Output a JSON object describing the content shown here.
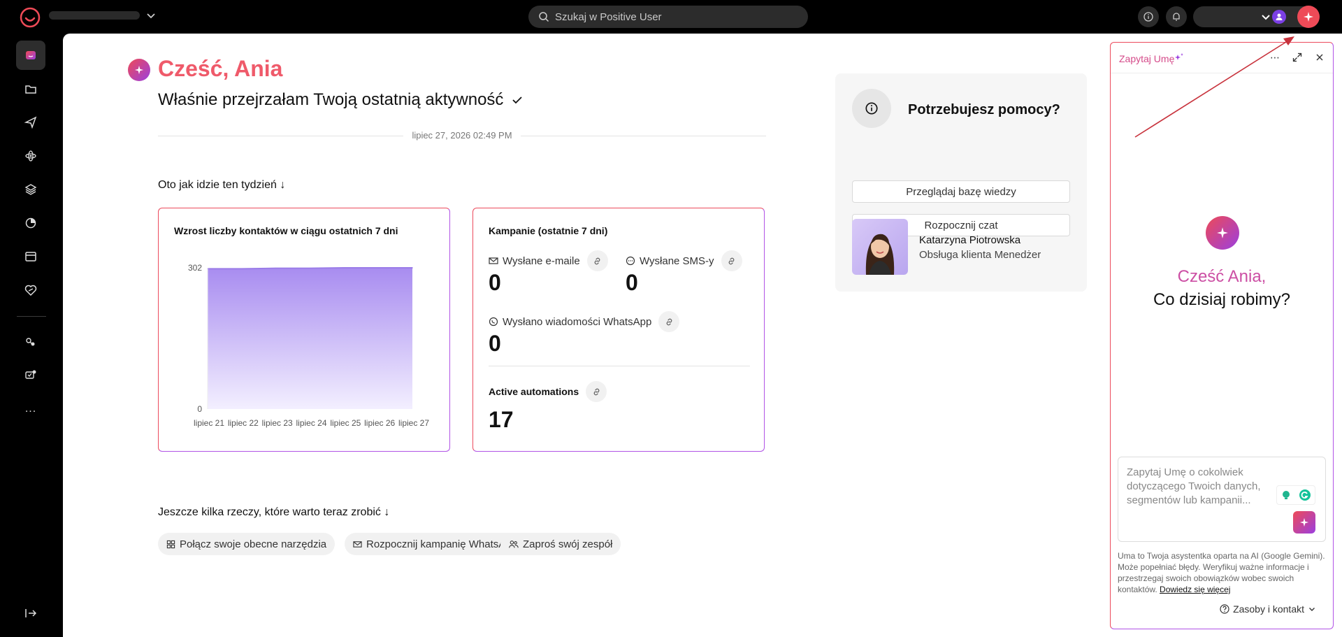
{
  "topbar": {
    "search_placeholder": "Szukaj w Positive User"
  },
  "colors": {
    "brand_red": "#ee4a57",
    "brand_purple": "#9b3fe0",
    "accent_pink": "#ef5a6a"
  },
  "sidebar": {
    "items": [
      {
        "icon": "home-icon",
        "active": true
      },
      {
        "icon": "folder-icon"
      },
      {
        "icon": "send-icon"
      },
      {
        "icon": "automation-icon"
      },
      {
        "icon": "layers-icon"
      },
      {
        "icon": "analytics-icon"
      },
      {
        "icon": "browser-icon"
      },
      {
        "icon": "loyalty-icon"
      },
      {
        "icon": "integrations-icon"
      },
      {
        "icon": "chat-settings-icon"
      },
      {
        "icon": "more-icon",
        "label": "..."
      },
      {
        "icon": "logout-icon"
      }
    ]
  },
  "main": {
    "greeting": "Cześć, Ania",
    "subtitle": "Właśnie przejrzałam Twoją ostatnią aktywność",
    "date": "lipiec 27, 2026 02:49 PM",
    "week_title": "Oto jak idzie ten tydzień",
    "todo_title": "Jeszcze kilka rzeczy, które warto teraz zrobić",
    "chips": [
      {
        "label": "Połącz swoje obecne narzędzia",
        "icon": "tools-icon"
      },
      {
        "label": "Rozpocznij kampanię WhatsApp",
        "icon": "mail-icon"
      },
      {
        "label": "Zaproś swój zespół",
        "icon": "team-icon"
      }
    ]
  },
  "contacts_card": {
    "title": "Wzrost liczby kontaktów w ciągu ostatnich 7 dni"
  },
  "chart_data": {
    "type": "area",
    "title": "Wzrost liczby kontaktów w ciągu ostatnich 7 dni",
    "categories": [
      "lipiec 21",
      "lipiec 22",
      "lipiec 23",
      "lipiec 24",
      "lipiec 25",
      "lipiec 26",
      "lipiec 27"
    ],
    "values": [
      300,
      300,
      301,
      301,
      302,
      302,
      302
    ],
    "yticks": [
      0,
      302
    ],
    "ylim": [
      0,
      302
    ],
    "xlabel": "",
    "ylabel": "",
    "grid": false
  },
  "campaign_card": {
    "title": "Kampanie (ostatnie 7 dni)",
    "emails_label": "Wysłane e-maile",
    "emails_value": "0",
    "sms_label": "Wysłane SMS-y",
    "sms_value": "0",
    "whatsapp_label": "Wysłano wiadomości WhatsApp",
    "whatsapp_value": "0",
    "automations_label": "Active automations",
    "automations_value": "17"
  },
  "help": {
    "title": "Potrzebujesz pomocy?",
    "kb_button": "Przeglądaj bazę wiedzy",
    "chat_button": "Rozpocznij czat",
    "manager_name": "Katarzyna Piotrowska",
    "manager_role": "Obsługa klienta Menedżer"
  },
  "ai_panel": {
    "title": "Zapytaj Umę",
    "greeting": "Cześć Ania,",
    "question": "Co dzisiaj robimy?",
    "input_placeholder": "Zapytaj Umę o cokolwiek dotyczącego Twoich danych, segmentów lub kampanii...",
    "disclaimer": "Uma to Twoja asystentka oparta na AI (Google Gemini). Może popełniać błędy. Weryfikuj ważne informacje i przestrzegaj swoich obowiązków wobec swoich kontaktów.",
    "learn_more": "Dowiedz się więcej",
    "resources": "Zasoby i kontakt"
  }
}
